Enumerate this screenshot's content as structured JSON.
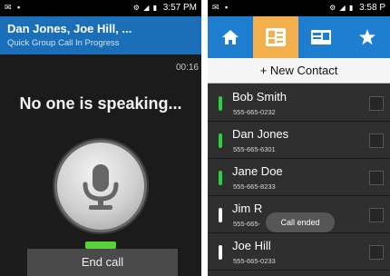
{
  "left_phone": {
    "status_time": "3:57 PM",
    "header": {
      "title": "Dan Jones, Joe Hill, ...",
      "subtitle": "Quick Group Call In Progress"
    },
    "timer": "00:16",
    "speaking_text": "No one is speaking...",
    "mic_level": 1,
    "end_call_label": "End call"
  },
  "right_phone": {
    "status_time": "3:58 P",
    "tabs": [
      {
        "icon": "home-icon"
      },
      {
        "icon": "contacts-icon",
        "active": true
      },
      {
        "icon": "contact-card-icon"
      },
      {
        "icon": "star-icon"
      }
    ],
    "new_contact_label": "+ New Contact",
    "contacts": [
      {
        "name": "Bob Smith",
        "phone": "555-665-0232",
        "status_color": "#27d23a"
      },
      {
        "name": "Dan Jones",
        "phone": "555-665-6301",
        "status_color": "#27d23a"
      },
      {
        "name": "Jane Doe",
        "phone": "555-665-8233",
        "status_color": "#27d23a"
      },
      {
        "name": "Jim R",
        "phone": "555-665-",
        "status_color": "#ffffff"
      },
      {
        "name": "Joe Hill",
        "phone": "555-665-0233",
        "status_color": "#ffffff"
      }
    ],
    "toast": "Call ended"
  },
  "colors": {
    "header_blue": "#1b6fb8",
    "tab_blue": "#1e7fd0",
    "tab_active": "#f3b04c",
    "online_green": "#27d23a"
  }
}
